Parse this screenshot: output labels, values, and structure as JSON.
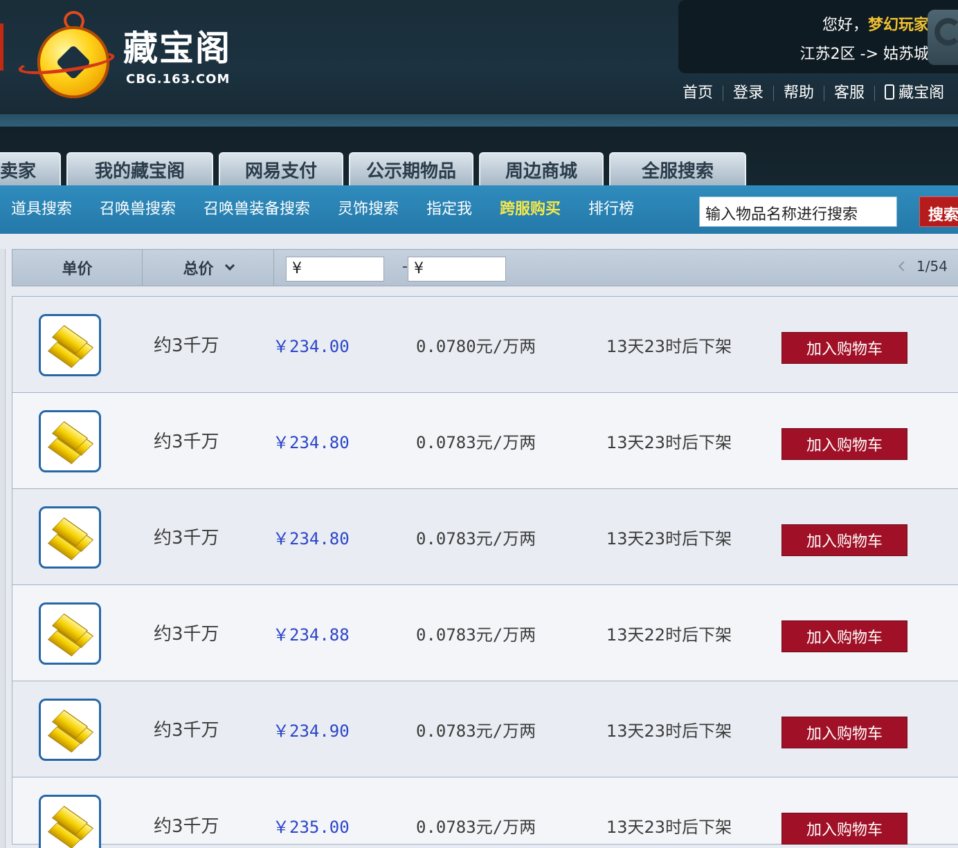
{
  "header": {
    "brand_title": "藏宝阁",
    "brand_sub": "CBG.163.COM",
    "greeting_prefix": "您好，",
    "player_name": "梦幻玩家",
    "server": "江苏2区 -> 姑苏城",
    "top_links": [
      "首页",
      "登录",
      "帮助",
      "客服",
      "藏宝阁"
    ]
  },
  "tabs": [
    "卖家",
    "我的藏宝阁",
    "网易支付",
    "公示期物品",
    "周边商城",
    "全服搜索"
  ],
  "subnav": {
    "items": [
      "道具搜索",
      "召唤兽搜索",
      "召唤兽装备搜索",
      "灵饰搜索",
      "指定我",
      "跨服购买",
      "排行榜"
    ],
    "highlight": "跨服购买",
    "search_placeholder": "输入物品名称进行搜索",
    "search_button": "搜索"
  },
  "filter": {
    "sort_unit": "单价",
    "sort_total": "总价",
    "price_min": "¥",
    "range_sep": "-",
    "price_max": "¥",
    "page": "1/54"
  },
  "listings": [
    {
      "amount": "约3千万",
      "price": "￥234.00",
      "unit_price": "0.0780元/万两",
      "time_left": "13天23时后下架",
      "action": "加入购物车"
    },
    {
      "amount": "约3千万",
      "price": "￥234.80",
      "unit_price": "0.0783元/万两",
      "time_left": "13天23时后下架",
      "action": "加入购物车"
    },
    {
      "amount": "约3千万",
      "price": "￥234.80",
      "unit_price": "0.0783元/万两",
      "time_left": "13天23时后下架",
      "action": "加入购物车"
    },
    {
      "amount": "约3千万",
      "price": "￥234.88",
      "unit_price": "0.0783元/万两",
      "time_left": "13天22时后下架",
      "action": "加入购物车"
    },
    {
      "amount": "约3千万",
      "price": "￥234.90",
      "unit_price": "0.0783元/万两",
      "time_left": "13天23时后下架",
      "action": "加入购物车"
    },
    {
      "amount": "约3千万",
      "price": "￥235.00",
      "unit_price": "0.0783元/万两",
      "time_left": "13天23时后下架",
      "action": "加入购物车"
    }
  ],
  "colors": {
    "accent_red": "#a01127",
    "price_blue": "#2a45c8",
    "nav_blue": "#2479a9",
    "highlight_yellow": "#f6e84a"
  },
  "icons": {
    "item": "gold-ingot-icon",
    "sort": "chevron-down-icon",
    "phone": "phone-icon"
  }
}
